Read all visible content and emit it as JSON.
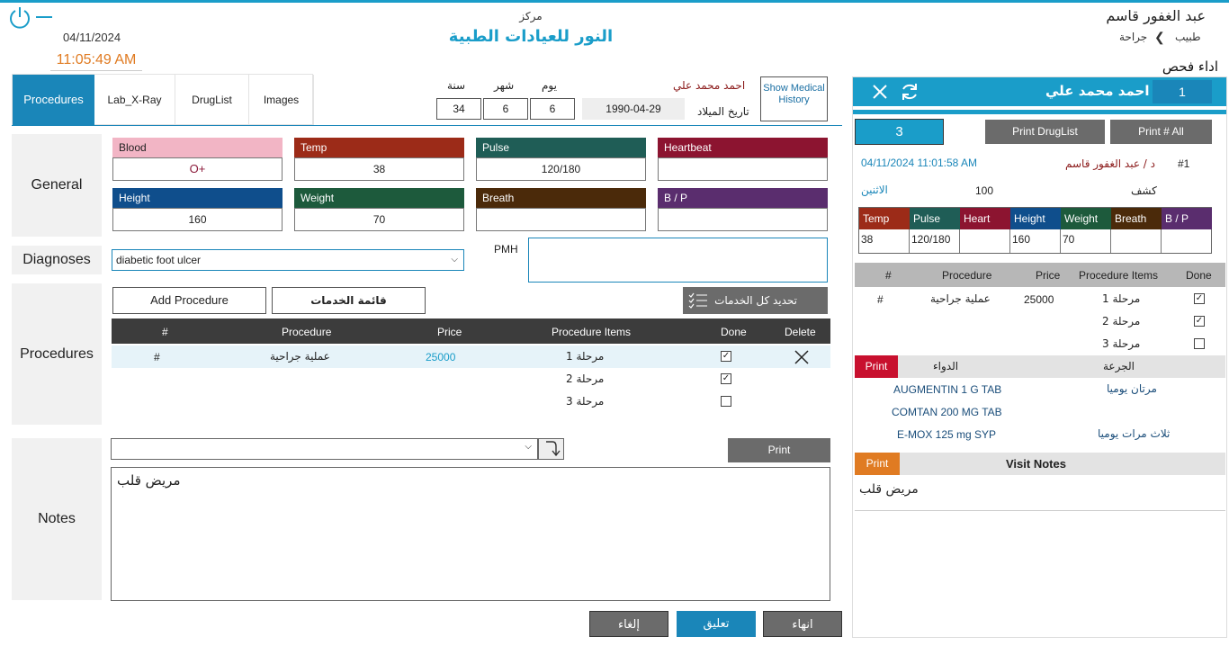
{
  "colors": {
    "accent": "#1a9dc9",
    "orange": "#e07b22"
  },
  "header": {
    "top_label": "مركز",
    "clinic_name": "النور للعيادات الطبية",
    "date": "04/11/2024",
    "time": "11:05:49 AM",
    "user_name": "عبد الغفور قاسم",
    "user_role": "طبيب",
    "user_dept": "جراحة",
    "page_action": "اداء فحص"
  },
  "tabs": [
    "Procedures",
    "Lab_X-Ray",
    "DrugList",
    "Images"
  ],
  "patient": {
    "name": "احمد محمد علي",
    "dob_label": "تاريخ الميلاد",
    "dob": "1990-04-29",
    "day_label": "يوم",
    "day": "6",
    "month_label": "شهر",
    "month": "6",
    "year_label": "سنة",
    "year": "34",
    "history_button": "Show Medical History"
  },
  "general": {
    "label": "General",
    "vitals": [
      {
        "label": "Blood",
        "value": "O+",
        "color": "#f2b5c5"
      },
      {
        "label": "Temp",
        "value": "38",
        "color": "#9c2b18"
      },
      {
        "label": "Pulse",
        "value": "120/180",
        "color": "#1f5d56"
      },
      {
        "label": "Heartbeat",
        "value": "",
        "color": "#8c1430"
      },
      {
        "label": "Height",
        "value": "160",
        "color": "#0f4e8c"
      },
      {
        "label": "Weight",
        "value": "70",
        "color": "#1d5a3c"
      },
      {
        "label": "Breath",
        "value": "",
        "color": "#4b2a0a"
      },
      {
        "label": "B / P",
        "value": "",
        "color": "#5a2d6e"
      }
    ]
  },
  "diagnoses": {
    "label": "Diagnoses",
    "value": "diabetic foot ulcer",
    "pmh_label": "PMH",
    "pmh_value": ""
  },
  "procedures": {
    "label": "Procedures",
    "add_button": "Add Procedure",
    "services_button": "قائمة الخدمات",
    "select_all_button": "تحديد كل الخدمات",
    "columns": [
      "#",
      "Procedure",
      "Price",
      "Procedure Items",
      "Done",
      "Delete"
    ],
    "row": {
      "num": "#",
      "name": "عملية جراحية",
      "price": "25000"
    },
    "items": [
      {
        "name": "مرحلة 1",
        "done": true
      },
      {
        "name": "مرحلة 2",
        "done": true
      },
      {
        "name": "مرحلة 3",
        "done": false
      }
    ]
  },
  "notes": {
    "label": "Notes",
    "print_button": "Print",
    "text": "مريض قلب",
    "template_value": ""
  },
  "footer": {
    "finish": "انهاء",
    "suspend": "تعليق",
    "cancel": "إلغاء"
  },
  "right_panel": {
    "queue_number": "1",
    "patient_name": "احمد محمد علي",
    "visit_count": "3",
    "print_druglist": "Print DrugList",
    "print_all": "Print # All",
    "visit_no": "#1",
    "doctor": "د / عبد الغفور قاسم",
    "visit_datetime": "04/11/2024 11:01:58 AM",
    "visit_type": "كشف",
    "visit_price": "100",
    "visit_day": "الاثنين",
    "vitals_headers": [
      "Temp",
      "Pulse",
      "Heart",
      "Height",
      "Weight",
      "Breath",
      "B / P"
    ],
    "vitals_colors": [
      "#9c2b18",
      "#1f5d56",
      "#8c1430",
      "#0f4e8c",
      "#1d5a3c",
      "#4b2a0a",
      "#5a2d6e"
    ],
    "vitals_values": [
      "38",
      "120/180",
      "",
      "160",
      "70",
      "",
      ""
    ],
    "proc_columns": [
      "#",
      "Procedure",
      "Price",
      "Procedure Items",
      "Done"
    ],
    "proc_row": {
      "num": "#",
      "name": "عملية جراحية",
      "price": "25000"
    },
    "proc_items": [
      {
        "name": "مرحلة 1",
        "done": true
      },
      {
        "name": "مرحلة 2",
        "done": true
      },
      {
        "name": "مرحلة 3",
        "done": false
      }
    ],
    "drug_print": "Print",
    "drug_label": "الدواء",
    "dose_label": "الجرعة",
    "drugs": [
      {
        "name": "AUGMENTIN 1 G TAB",
        "dose": "مرتان يوميا"
      },
      {
        "name": "COMTAN 200 MG TAB",
        "dose": ""
      },
      {
        "name": "E-MOX 125 mg SYP",
        "dose": "ثلاث مرات يوميا"
      }
    ],
    "notes_print": "Print",
    "notes_title": "Visit Notes",
    "notes_text": "مريض قلب"
  }
}
